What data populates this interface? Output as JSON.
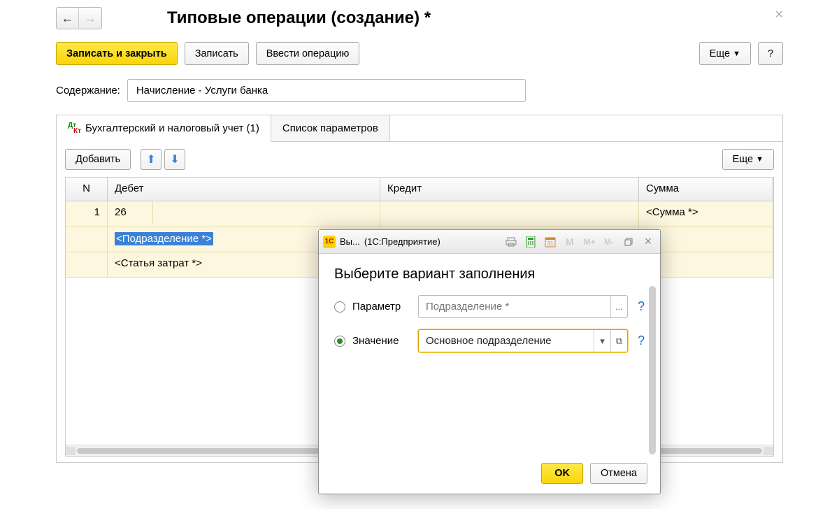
{
  "header": {
    "title": "Типовые операции (создание) *"
  },
  "toolbar": {
    "save_close": "Записать и закрыть",
    "save": "Записать",
    "enter_op": "Ввести операцию",
    "more": "Еще",
    "help": "?"
  },
  "content_row": {
    "label": "Содержание:",
    "value": "Начисление - Услуги банка"
  },
  "tabs": {
    "accounting": "Бухгалтерский и налоговый учет (1)",
    "params": "Список параметров"
  },
  "subtoolbar": {
    "add": "Добавить",
    "more": "Еще"
  },
  "table": {
    "cols": {
      "n": "N",
      "debit": "Дебет",
      "credit": "Кредит",
      "sum": "Сумма"
    },
    "rows": [
      {
        "n": "1",
        "debit_account": "26",
        "debit_sub1": "<Подразделение *>",
        "debit_sub2": "<Статья затрат *>",
        "sum": "<Сумма *>"
      }
    ]
  },
  "dialog": {
    "win_title_short": "Вы...",
    "win_title_app": "(1С:Предприятие)",
    "heading": "Выберите вариант заполнения",
    "opt_param": "Параметр",
    "opt_value": "Значение",
    "param_field": "Подразделение *",
    "param_more": "...",
    "value_field": "Основное подразделение",
    "help": "?",
    "m": "M",
    "m_plus": "M+",
    "m_minus": "M-",
    "ok": "OK",
    "cancel": "Отмена",
    "dropdown_glyph": "▾",
    "open_glyph": "⧉"
  }
}
